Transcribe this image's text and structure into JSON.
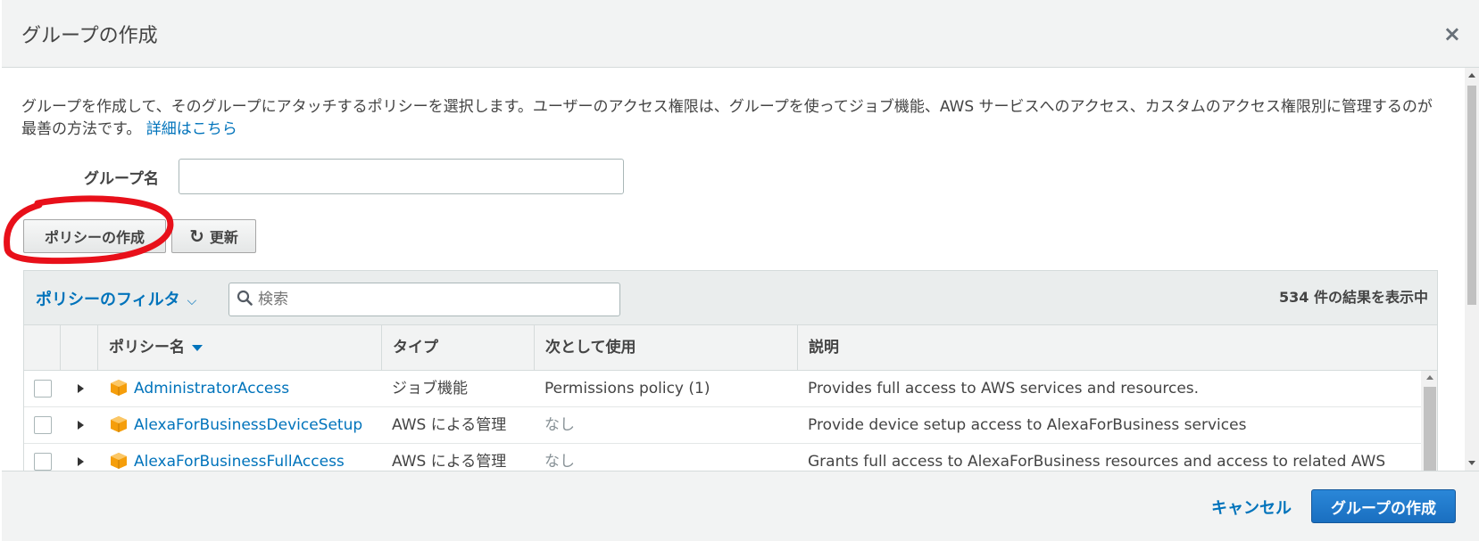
{
  "modal": {
    "title": "グループの作成",
    "close_label": "×"
  },
  "description": {
    "text": "グループを作成して、そのグループにアタッチするポリシーを選択します。ユーザーのアクセス権限は、グループを使ってジョブ機能、AWS サービスへのアクセス、カスタムのアクセス権限別に管理するのが最善の方法です。",
    "link_label": "詳細はこちら"
  },
  "form": {
    "group_name_label": "グループ名",
    "group_name_value": ""
  },
  "actions": {
    "create_policy_label": "ポリシーの作成",
    "refresh_icon": "↻",
    "refresh_label": "更新"
  },
  "filter": {
    "dropdown_label": "ポリシーのフィルタ",
    "dropdown_chevron": "⌵",
    "search_icon": "🔍",
    "search_placeholder": "検索",
    "result_count": "534 件の結果を表示中"
  },
  "table": {
    "columns": {
      "policy_name": "ポリシー名",
      "type": "タイプ",
      "used_as": "次として使用",
      "description": "説明"
    },
    "rows": [
      {
        "name": "AdministratorAccess",
        "type": "ジョブ機能",
        "used_as": "Permissions policy (1)",
        "description": "Provides full access to AWS services and resources."
      },
      {
        "name": "AlexaForBusinessDeviceSetup",
        "type": "AWS による管理",
        "used_as": "なし",
        "description": "Provide device setup access to AlexaForBusiness services"
      },
      {
        "name": "AlexaForBusinessFullAccess",
        "type": "AWS による管理",
        "used_as": "なし",
        "description": "Grants full access to AlexaForBusiness resources and access to related AWS"
      }
    ]
  },
  "footer": {
    "cancel_label": "キャンセル",
    "create_group_label": "グループの作成"
  },
  "colors": {
    "link_blue": "#0073bb",
    "primary_button": "#1a6fc0",
    "annotation_red": "#e8101a",
    "policy_icon_orange": "#f59e0b"
  }
}
